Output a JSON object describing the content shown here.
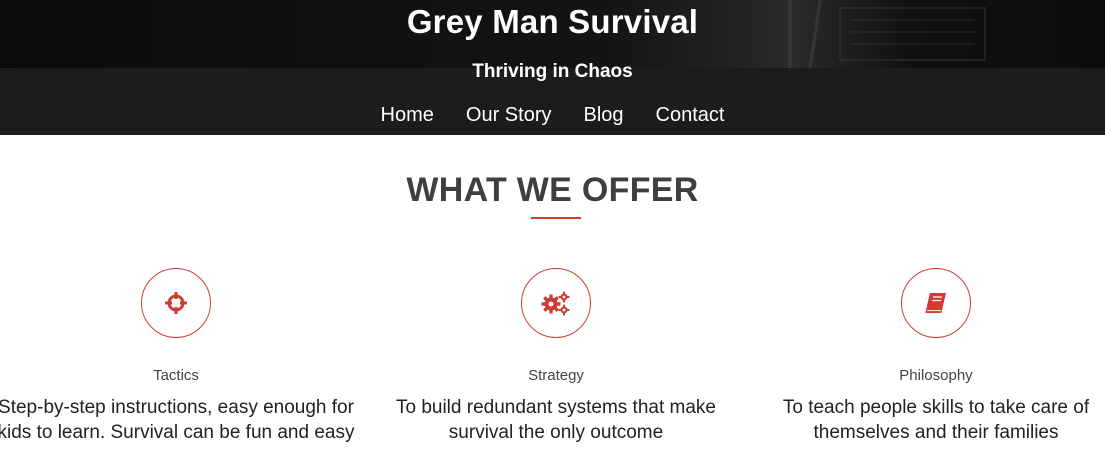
{
  "header": {
    "site_title": "Grey Man Survival",
    "tagline": "Thriving in Chaos",
    "nav": [
      {
        "label": "Home"
      },
      {
        "label": "Our Story"
      },
      {
        "label": "Blog"
      },
      {
        "label": "Contact"
      }
    ]
  },
  "offer": {
    "title": "WHAT WE OFFER",
    "features": [
      {
        "icon": "crosshairs-icon",
        "label": "Tactics",
        "description": "Step-by-step instructions, easy enough for kids to learn. Survival can be fun and easy"
      },
      {
        "icon": "gears-icon",
        "label": "Strategy",
        "description": "To build redundant systems that make survival the only outcome"
      },
      {
        "icon": "book-icon",
        "label": "Philosophy",
        "description": "To teach people skills to take care of themselves and their families"
      }
    ]
  },
  "colors": {
    "accent": "#d03b32",
    "header_dark": "#1c1c1c",
    "text_dark": "#3f3f3f"
  }
}
